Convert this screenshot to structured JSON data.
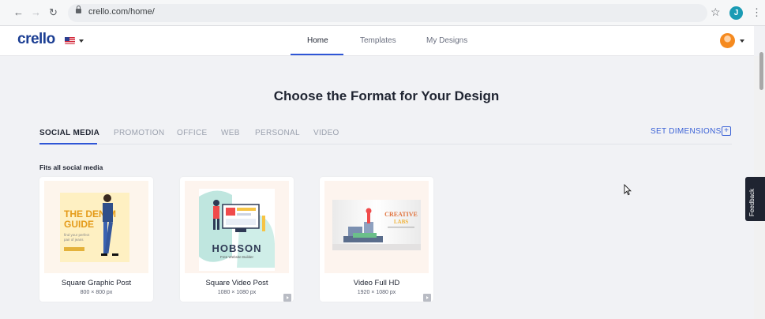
{
  "browser": {
    "url": "crello.com/home/",
    "profile_initial": "J"
  },
  "header": {
    "logo": "crello",
    "nav": [
      {
        "label": "Home"
      },
      {
        "label": "Templates"
      },
      {
        "label": "My Designs"
      }
    ]
  },
  "feedback_label": "Feedback",
  "main": {
    "heading": "Choose the Format for Your Design",
    "format_tabs": [
      {
        "label": "SOCIAL MEDIA"
      },
      {
        "label": "PROMOTION"
      },
      {
        "label": "OFFICE"
      },
      {
        "label": "WEB"
      },
      {
        "label": "PERSONAL"
      },
      {
        "label": "VIDEO"
      }
    ],
    "set_dimensions": "SET DIMENSIONS",
    "section_title": "Fits all social media",
    "cards": [
      {
        "title": "Square Graphic Post",
        "size": "800 × 800 px"
      },
      {
        "title": "Square Video Post",
        "size": "1080 × 1080 px"
      },
      {
        "title": "Video Full HD",
        "size": "1920 × 1080 px"
      }
    ]
  },
  "thumbnails": {
    "denim": {
      "line1": "THE DENIM",
      "line2": "GUIDE",
      "small1": "find your perfect",
      "small2": "pair of jeans"
    },
    "hobson": {
      "brand": "HOBSON",
      "tagline": "Free Website Builder"
    },
    "labs": {
      "line1": "CREATIVE",
      "line2": "LABS"
    }
  },
  "colors": {
    "accent": "#2f56d6",
    "logo": "#1b3e93",
    "page_bg": "#f1f2f5"
  }
}
